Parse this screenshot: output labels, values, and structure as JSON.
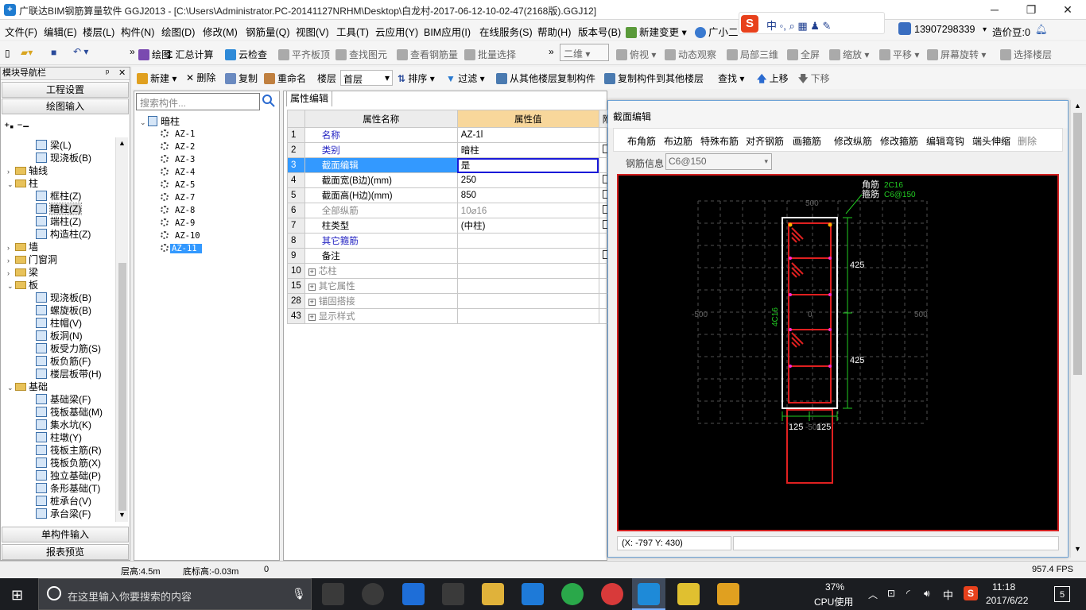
{
  "titlebar": {
    "title": "广联达BIM钢筋算量软件 GGJ2013 - [C:\\Users\\Administrator.PC-20141127NRHM\\Desktop\\白龙村-2017-06-12-10-02-47(2168版).GGJ12]",
    "minimize": "─",
    "restore": "❐",
    "close": "✕"
  },
  "menu": [
    "文件(F)",
    "编辑(E)",
    "楼层(L)",
    "构件(N)",
    "绘图(D)",
    "修改(M)",
    "钢筋量(Q)",
    "视图(V)",
    "工具(T)",
    "云应用(Y)",
    "BIM应用(I)",
    "在线服务(S)",
    "帮助(H)",
    "版本号(B)",
    "新建变更",
    "广小二"
  ],
  "account": {
    "phone": "13907298339",
    "coin": "造价豆:0"
  },
  "toolbar1": [
    "绘图",
    "汇总计算",
    "云检查",
    "平齐板顶",
    "查找图元",
    "查看钢筋量",
    "批量选择",
    "二维",
    "俯视",
    "动态观察",
    "局部三维",
    "全屏",
    "缩放",
    "平移",
    "屏幕旋转",
    "选择楼层"
  ],
  "toolbar2": [
    "新建",
    "删除",
    "复制",
    "重命名",
    "楼层",
    "首层",
    "排序",
    "过滤",
    "从其他楼层复制构件",
    "复制构件到其他楼层",
    "查找",
    "上移",
    "下移"
  ],
  "nav": {
    "header": "模块导航栏",
    "pin": "ᵖ",
    "close": "✕",
    "btn_project": "工程设置",
    "btn_draw": "绘图输入",
    "btn_single": "单构件输入",
    "btn_report": "报表预览",
    "tree": [
      {
        "label": "梁(L)",
        "level": 2,
        "type": "item"
      },
      {
        "label": "现浇板(B)",
        "level": 2,
        "type": "item"
      },
      {
        "label": "轴线",
        "level": 0,
        "type": "folder",
        "exp": "›"
      },
      {
        "label": "柱",
        "level": 0,
        "type": "folder",
        "exp": "⌄"
      },
      {
        "label": "框柱(Z)",
        "level": 2,
        "type": "item"
      },
      {
        "label": "暗柱(Z)",
        "level": 2,
        "type": "item",
        "selected": true
      },
      {
        "label": "端柱(Z)",
        "level": 2,
        "type": "item"
      },
      {
        "label": "构造柱(Z)",
        "level": 2,
        "type": "item"
      },
      {
        "label": "墙",
        "level": 0,
        "type": "folder",
        "exp": "›"
      },
      {
        "label": "门窗洞",
        "level": 0,
        "type": "folder",
        "exp": "›"
      },
      {
        "label": "梁",
        "level": 0,
        "type": "folder",
        "exp": "›"
      },
      {
        "label": "板",
        "level": 0,
        "type": "folder",
        "exp": "⌄"
      },
      {
        "label": "现浇板(B)",
        "level": 2,
        "type": "item"
      },
      {
        "label": "螺旋板(B)",
        "level": 2,
        "type": "item"
      },
      {
        "label": "柱帽(V)",
        "level": 2,
        "type": "item"
      },
      {
        "label": "板洞(N)",
        "level": 2,
        "type": "item"
      },
      {
        "label": "板受力筋(S)",
        "level": 2,
        "type": "item"
      },
      {
        "label": "板负筋(F)",
        "level": 2,
        "type": "item"
      },
      {
        "label": "楼层板带(H)",
        "level": 2,
        "type": "item"
      },
      {
        "label": "基础",
        "level": 0,
        "type": "folder",
        "exp": "⌄"
      },
      {
        "label": "基础梁(F)",
        "level": 2,
        "type": "item"
      },
      {
        "label": "筏板基础(M)",
        "level": 2,
        "type": "item"
      },
      {
        "label": "集水坑(K)",
        "level": 2,
        "type": "item"
      },
      {
        "label": "柱墩(Y)",
        "level": 2,
        "type": "item"
      },
      {
        "label": "筏板主筋(R)",
        "level": 2,
        "type": "item"
      },
      {
        "label": "筏板负筋(X)",
        "level": 2,
        "type": "item"
      },
      {
        "label": "独立基础(P)",
        "level": 2,
        "type": "item"
      },
      {
        "label": "条形基础(T)",
        "level": 2,
        "type": "item"
      },
      {
        "label": "桩承台(V)",
        "level": 2,
        "type": "item"
      },
      {
        "label": "承台梁(F)",
        "level": 2,
        "type": "item"
      }
    ]
  },
  "complist": {
    "search_placeholder": "搜索构件...",
    "root": "暗柱",
    "items": [
      "AZ-1",
      "AZ-2",
      "AZ-3",
      "AZ-4",
      "AZ-5",
      "AZ-7",
      "AZ-8",
      "AZ-9",
      "AZ-10",
      "AZ-11"
    ],
    "selected": "AZ-11"
  },
  "props": {
    "tab": "属性编辑",
    "headers": [
      "属性名称",
      "属性值",
      "附"
    ],
    "rows": [
      {
        "num": "1",
        "name": "名称",
        "value": "AZ-1l",
        "style": "blue",
        "chk": false
      },
      {
        "num": "2",
        "name": "类别",
        "value": "暗柱",
        "style": "blue",
        "chk": true
      },
      {
        "num": "3",
        "name": "截面编辑",
        "value": "是",
        "style": "selected",
        "chk": false
      },
      {
        "num": "4",
        "name": "截面宽(B边)(mm)",
        "value": "250",
        "style": "normal",
        "chk": true
      },
      {
        "num": "5",
        "name": "截面高(H边)(mm)",
        "value": "850",
        "style": "normal",
        "chk": true
      },
      {
        "num": "6",
        "name": "全部纵筋",
        "value": "10⌀16",
        "style": "gray",
        "chk": true
      },
      {
        "num": "7",
        "name": "柱类型",
        "value": "(中柱)",
        "style": "normal",
        "chk": true
      },
      {
        "num": "8",
        "name": "其它箍筋",
        "value": "",
        "style": "blue",
        "chk": false
      },
      {
        "num": "9",
        "name": "备注",
        "value": "",
        "style": "normal",
        "chk": true
      },
      {
        "num": "10",
        "name": "芯柱",
        "value": "",
        "style": "group",
        "chk": false
      },
      {
        "num": "15",
        "name": "其它属性",
        "value": "",
        "style": "group",
        "chk": false
      },
      {
        "num": "28",
        "name": "锚固搭接",
        "value": "",
        "style": "group",
        "chk": false
      },
      {
        "num": "43",
        "name": "显示样式",
        "value": "",
        "style": "group",
        "chk": false
      }
    ]
  },
  "section": {
    "title": "截面编辑",
    "buttons": [
      "布角筋",
      "布边筋",
      "特殊布筋",
      "对齐钢筋",
      "画箍筋",
      "修改纵筋",
      "修改箍筋",
      "编辑弯钩",
      "端头伸缩",
      "删除"
    ],
    "rebar_label": "钢筋信息",
    "rebar_value": "C6@150",
    "corner_label": "角筋",
    "corner_value": "2C16",
    "stirrup_label": "箍筋",
    "stirrup_value": "C6@150",
    "side_label": "4C16",
    "dim_425a": "425",
    "dim_425b": "425",
    "dim_125a": "125",
    "dim_125b": "125",
    "grid_500_top": "500",
    "grid_500_left": "-500",
    "grid_500_right": "500",
    "grid_0": "0",
    "grid_bottom": "-500",
    "coord": "(X: -797 Y: 430)"
  },
  "status": {
    "floor_h": "层高:4.5m",
    "base_h": "底标高:-0.03m",
    "zero": "0",
    "fps": "957.4 FPS"
  },
  "taskbar": {
    "search_placeholder": "在这里输入你要搜索的内容",
    "cpu_pct": "37%",
    "cpu_label": "CPU使用",
    "time": "11:18",
    "date": "2017/6/22",
    "ime": "中",
    "notif": "5"
  }
}
